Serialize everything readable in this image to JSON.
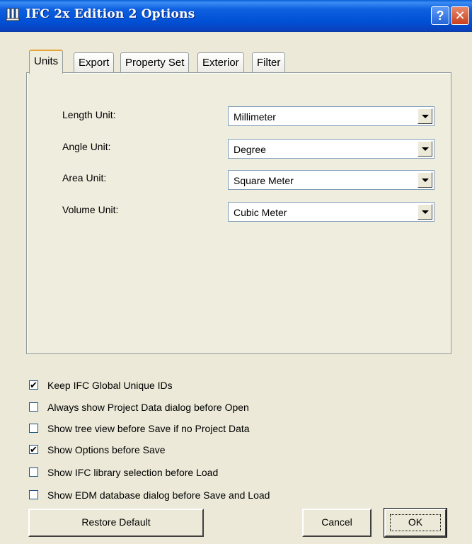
{
  "window": {
    "title": "IFC 2x Edition 2 Options",
    "help_label": "?",
    "close_label": "✕"
  },
  "tabs": [
    {
      "label": "Units",
      "active": true
    },
    {
      "label": "Export",
      "active": false
    },
    {
      "label": "Property Set",
      "active": false
    },
    {
      "label": "Exterior",
      "active": false
    },
    {
      "label": "Filter",
      "active": false
    }
  ],
  "units": [
    {
      "label": "Length Unit:",
      "value": "Millimeter"
    },
    {
      "label": "Angle Unit:",
      "value": "Degree"
    },
    {
      "label": "Area Unit:",
      "value": "Square Meter"
    },
    {
      "label": "Volume Unit:",
      "value": "Cubic Meter"
    }
  ],
  "options": [
    {
      "label": "Keep IFC Global Unique IDs",
      "checked": true
    },
    {
      "label": "Always show Project Data dialog before Open",
      "checked": false
    },
    {
      "label": "Show tree view before Save if no Project Data",
      "checked": false
    },
    {
      "label": "Show Options before Save",
      "checked": true
    },
    {
      "label": "Show IFC library selection before Load",
      "checked": false
    },
    {
      "label": "Show EDM database dialog before Save and Load",
      "checked": false
    }
  ],
  "buttons": {
    "restore_default": "Restore Default",
    "cancel": "Cancel",
    "ok": "OK"
  },
  "colors": {
    "titlebar": "#0050d5",
    "dialog_bg": "#ece9d8",
    "active_tab_accent": "#e7a536"
  }
}
